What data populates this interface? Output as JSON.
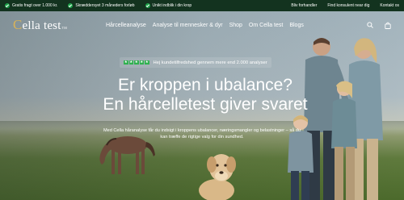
{
  "topbar": {
    "usps": [
      {
        "icon": "check-circle-icon",
        "text": "Gratis fragt over 1.000 kr."
      },
      {
        "icon": "check-circle-icon",
        "text": "Skræddersyet 3 måneders forløb"
      },
      {
        "icon": "check-circle-icon",
        "text": "Unikt indblik i din krop"
      }
    ],
    "links": [
      "Bliv forhandler",
      "Find konsulent near dig",
      "Kontakt os"
    ]
  },
  "nav": {
    "logo": {
      "initial": "C",
      "rest": "ella test",
      "tm": "TM"
    },
    "menu": [
      "Hårcelleanalyse",
      "Analyse til mennesker & dyr",
      "Shop",
      "Om Cella test",
      "Blogs"
    ],
    "icons": [
      "search-icon",
      "shopping-bag-icon"
    ]
  },
  "hero": {
    "rating_text": "Hej kundetilfredshed gennem mere end 2.000 analyser",
    "stars": 5,
    "headline_line1": "Er kroppen i ubalance?",
    "headline_line2": "En hårcelletest giver svaret",
    "subtext": "Med Cella håranalyse får du indsigt i kroppens ubalancer, næringsmangler og belastninger – så du kan træffe de rigtige valg for din sundhed."
  },
  "colors": {
    "topbar_bg": "#13331f",
    "check_green": "#1ea34a",
    "star_green": "#2fb14f",
    "logo_gold": "#d7b25a"
  }
}
